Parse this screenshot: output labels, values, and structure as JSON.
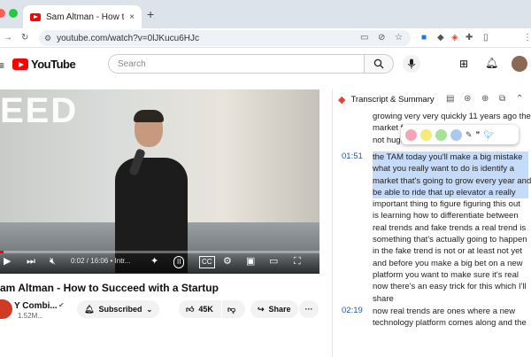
{
  "browser": {
    "tab_title": "Sam Altman - How to Succee",
    "tab_close": "×",
    "new_tab": "+",
    "url": "youtube.com/watch?v=0lJKucu6HJc",
    "traffic_colors": [
      "#ff5f57",
      "#febc2e",
      "#28c840"
    ]
  },
  "youtube": {
    "logo_text": "YouTube",
    "search_placeholder": "Search"
  },
  "video": {
    "overlay_text": "EED",
    "time": "0:02 / 16:06",
    "chapter": "• Intr...",
    "progress": 0.01
  },
  "meta": {
    "title": "am Altman - How to Succeed with a Startup",
    "channel": "Y Combi...",
    "subs": "1.52M...",
    "subscribed_label": "Subscribed",
    "likes": "45K",
    "share_label": "Share",
    "more": "···"
  },
  "panel": {
    "title": "Transcript & Summary",
    "segments": [
      {
        "ts": "",
        "lines": [
          "growing very very quickly 11 years ago the",
          "market f... ...",
          "not huge..."
        ],
        "highlight": []
      },
      {
        "ts": "01:51",
        "lines": [
          "the TAM today you'll make a big mistake",
          "what you really want to do is identify a",
          "market that's going to grow every year and",
          "be able to ride that up elevator a really",
          "important thing to figure figuring this out",
          "is learning how to differentiate between",
          "real trends and fake trends a real trend is",
          "something that's actually going to happen",
          "in the fake trend is not or at least not yet",
          "and before you make a big bet on a new",
          "platform you want to make sure it's real",
          "now there's an easy trick for this which I'll",
          "share"
        ],
        "highlight": [
          0,
          1,
          2,
          3
        ]
      },
      {
        "ts": "02:19",
        "lines": [
          "now real trends are ones where a new",
          "technology platform comes along and the"
        ],
        "highlight": []
      }
    ],
    "highlight_colors": [
      "#f4a6b8",
      "#f7ea7a",
      "#a6e39a",
      "#a9c8f2"
    ]
  }
}
